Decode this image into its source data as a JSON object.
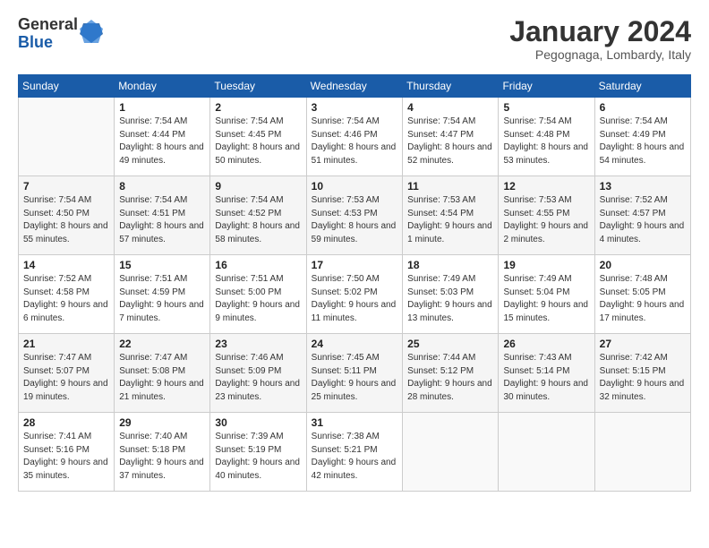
{
  "header": {
    "logo_general": "General",
    "logo_blue": "Blue",
    "month_title": "January 2024",
    "subtitle": "Pegognaga, Lombardy, Italy"
  },
  "days_of_week": [
    "Sunday",
    "Monday",
    "Tuesday",
    "Wednesday",
    "Thursday",
    "Friday",
    "Saturday"
  ],
  "weeks": [
    [
      {
        "day": "",
        "sunrise": "",
        "sunset": "",
        "daylight": ""
      },
      {
        "day": "1",
        "sunrise": "Sunrise: 7:54 AM",
        "sunset": "Sunset: 4:44 PM",
        "daylight": "Daylight: 8 hours and 49 minutes."
      },
      {
        "day": "2",
        "sunrise": "Sunrise: 7:54 AM",
        "sunset": "Sunset: 4:45 PM",
        "daylight": "Daylight: 8 hours and 50 minutes."
      },
      {
        "day": "3",
        "sunrise": "Sunrise: 7:54 AM",
        "sunset": "Sunset: 4:46 PM",
        "daylight": "Daylight: 8 hours and 51 minutes."
      },
      {
        "day": "4",
        "sunrise": "Sunrise: 7:54 AM",
        "sunset": "Sunset: 4:47 PM",
        "daylight": "Daylight: 8 hours and 52 minutes."
      },
      {
        "day": "5",
        "sunrise": "Sunrise: 7:54 AM",
        "sunset": "Sunset: 4:48 PM",
        "daylight": "Daylight: 8 hours and 53 minutes."
      },
      {
        "day": "6",
        "sunrise": "Sunrise: 7:54 AM",
        "sunset": "Sunset: 4:49 PM",
        "daylight": "Daylight: 8 hours and 54 minutes."
      }
    ],
    [
      {
        "day": "7",
        "sunrise": "Sunrise: 7:54 AM",
        "sunset": "Sunset: 4:50 PM",
        "daylight": "Daylight: 8 hours and 55 minutes."
      },
      {
        "day": "8",
        "sunrise": "Sunrise: 7:54 AM",
        "sunset": "Sunset: 4:51 PM",
        "daylight": "Daylight: 8 hours and 57 minutes."
      },
      {
        "day": "9",
        "sunrise": "Sunrise: 7:54 AM",
        "sunset": "Sunset: 4:52 PM",
        "daylight": "Daylight: 8 hours and 58 minutes."
      },
      {
        "day": "10",
        "sunrise": "Sunrise: 7:53 AM",
        "sunset": "Sunset: 4:53 PM",
        "daylight": "Daylight: 8 hours and 59 minutes."
      },
      {
        "day": "11",
        "sunrise": "Sunrise: 7:53 AM",
        "sunset": "Sunset: 4:54 PM",
        "daylight": "Daylight: 9 hours and 1 minute."
      },
      {
        "day": "12",
        "sunrise": "Sunrise: 7:53 AM",
        "sunset": "Sunset: 4:55 PM",
        "daylight": "Daylight: 9 hours and 2 minutes."
      },
      {
        "day": "13",
        "sunrise": "Sunrise: 7:52 AM",
        "sunset": "Sunset: 4:57 PM",
        "daylight": "Daylight: 9 hours and 4 minutes."
      }
    ],
    [
      {
        "day": "14",
        "sunrise": "Sunrise: 7:52 AM",
        "sunset": "Sunset: 4:58 PM",
        "daylight": "Daylight: 9 hours and 6 minutes."
      },
      {
        "day": "15",
        "sunrise": "Sunrise: 7:51 AM",
        "sunset": "Sunset: 4:59 PM",
        "daylight": "Daylight: 9 hours and 7 minutes."
      },
      {
        "day": "16",
        "sunrise": "Sunrise: 7:51 AM",
        "sunset": "Sunset: 5:00 PM",
        "daylight": "Daylight: 9 hours and 9 minutes."
      },
      {
        "day": "17",
        "sunrise": "Sunrise: 7:50 AM",
        "sunset": "Sunset: 5:02 PM",
        "daylight": "Daylight: 9 hours and 11 minutes."
      },
      {
        "day": "18",
        "sunrise": "Sunrise: 7:49 AM",
        "sunset": "Sunset: 5:03 PM",
        "daylight": "Daylight: 9 hours and 13 minutes."
      },
      {
        "day": "19",
        "sunrise": "Sunrise: 7:49 AM",
        "sunset": "Sunset: 5:04 PM",
        "daylight": "Daylight: 9 hours and 15 minutes."
      },
      {
        "day": "20",
        "sunrise": "Sunrise: 7:48 AM",
        "sunset": "Sunset: 5:05 PM",
        "daylight": "Daylight: 9 hours and 17 minutes."
      }
    ],
    [
      {
        "day": "21",
        "sunrise": "Sunrise: 7:47 AM",
        "sunset": "Sunset: 5:07 PM",
        "daylight": "Daylight: 9 hours and 19 minutes."
      },
      {
        "day": "22",
        "sunrise": "Sunrise: 7:47 AM",
        "sunset": "Sunset: 5:08 PM",
        "daylight": "Daylight: 9 hours and 21 minutes."
      },
      {
        "day": "23",
        "sunrise": "Sunrise: 7:46 AM",
        "sunset": "Sunset: 5:09 PM",
        "daylight": "Daylight: 9 hours and 23 minutes."
      },
      {
        "day": "24",
        "sunrise": "Sunrise: 7:45 AM",
        "sunset": "Sunset: 5:11 PM",
        "daylight": "Daylight: 9 hours and 25 minutes."
      },
      {
        "day": "25",
        "sunrise": "Sunrise: 7:44 AM",
        "sunset": "Sunset: 5:12 PM",
        "daylight": "Daylight: 9 hours and 28 minutes."
      },
      {
        "day": "26",
        "sunrise": "Sunrise: 7:43 AM",
        "sunset": "Sunset: 5:14 PM",
        "daylight": "Daylight: 9 hours and 30 minutes."
      },
      {
        "day": "27",
        "sunrise": "Sunrise: 7:42 AM",
        "sunset": "Sunset: 5:15 PM",
        "daylight": "Daylight: 9 hours and 32 minutes."
      }
    ],
    [
      {
        "day": "28",
        "sunrise": "Sunrise: 7:41 AM",
        "sunset": "Sunset: 5:16 PM",
        "daylight": "Daylight: 9 hours and 35 minutes."
      },
      {
        "day": "29",
        "sunrise": "Sunrise: 7:40 AM",
        "sunset": "Sunset: 5:18 PM",
        "daylight": "Daylight: 9 hours and 37 minutes."
      },
      {
        "day": "30",
        "sunrise": "Sunrise: 7:39 AM",
        "sunset": "Sunset: 5:19 PM",
        "daylight": "Daylight: 9 hours and 40 minutes."
      },
      {
        "day": "31",
        "sunrise": "Sunrise: 7:38 AM",
        "sunset": "Sunset: 5:21 PM",
        "daylight": "Daylight: 9 hours and 42 minutes."
      },
      {
        "day": "",
        "sunrise": "",
        "sunset": "",
        "daylight": ""
      },
      {
        "day": "",
        "sunrise": "",
        "sunset": "",
        "daylight": ""
      },
      {
        "day": "",
        "sunrise": "",
        "sunset": "",
        "daylight": ""
      }
    ]
  ]
}
